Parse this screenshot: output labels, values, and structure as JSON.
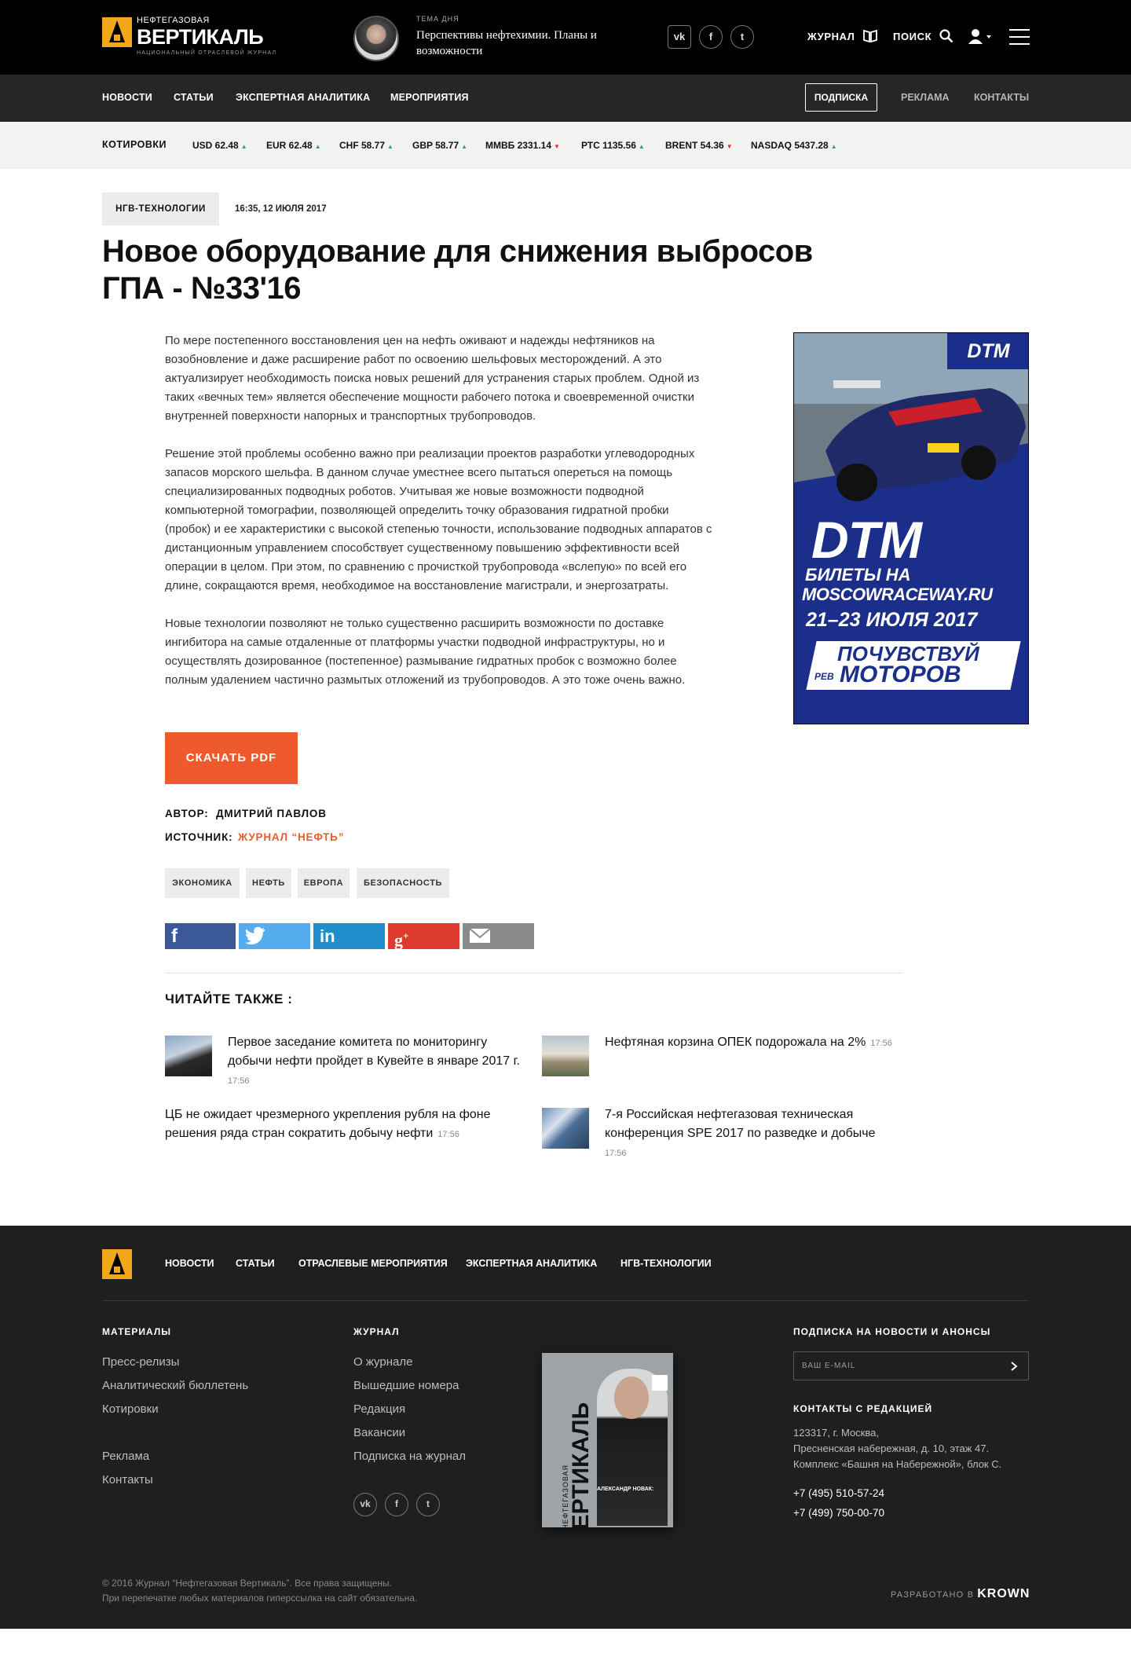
{
  "header": {
    "logo_small": "НЕФТЕГАЗОВАЯ",
    "logo_big": "ВЕРТИКАЛЬ",
    "logo_sub": "НАЦИОНАЛЬНЫЙ ОТРАСЛЕВОЙ ЖУРНАЛ",
    "theme_label": "ТЕМА ДНЯ",
    "theme_text": "Перспективы нефтехимии. Планы и возможности",
    "social": [
      "vk-icon",
      "facebook-icon",
      "twitter-icon"
    ],
    "journal_label": "ЖУРНАЛ",
    "search_label": "ПОИСК"
  },
  "nav": {
    "items": [
      "НОВОСТИ",
      "СТАТЬИ",
      "ЭКСПЕРТНАЯ АНАЛИТИКА",
      "МЕРОПРИЯТИЯ"
    ],
    "subscribe": "ПОДПИСКА",
    "ads": "РЕКЛАМА",
    "contacts": "КОНТАКТЫ"
  },
  "quotes": {
    "title": "КОТИРОВКИ",
    "items": [
      {
        "label": "USD 62.48",
        "dir": "up"
      },
      {
        "label": "EUR 62.48",
        "dir": "up"
      },
      {
        "label": "CHF 58.77",
        "dir": "up"
      },
      {
        "label": "GBP 58.77",
        "dir": "up"
      },
      {
        "label": "ММВБ 2331.14",
        "dir": "down"
      },
      {
        "label": "РТС 1135.56",
        "dir": "up"
      },
      {
        "label": "BRENT 54.36",
        "dir": "down"
      },
      {
        "label": "NASDAQ 5437.28",
        "dir": "up"
      }
    ]
  },
  "article": {
    "category": "НГВ-ТЕХНОЛОГИИ",
    "date": "16:35, 12 ИЮЛЯ 2017",
    "title": "Новое оборудование для снижения выбросов ГПА - №33'16",
    "p1": "По мере постепенного восстановления цен на нефть оживают и надежды нефтяников на возобновление и даже расширение работ по освоению шельфовых месторождений. А это актуализирует необходимость поиска новых решений для устранения старых проблем. Одной из таких «вечных тем» является обеспечение мощности рабочего потока и своевременной очистки внутренней поверхности напорных и транспортных трубопроводов.",
    "p2": "Решение этой проблемы особенно важно при реализации проектов разработки углеводородных запасов морского шельфа. В данном случае уместнее всего пытаться опереться на помощь специализированных подводных роботов. Учитывая же новые возможности подводной компьютерной томографии, позволяющей определить точку образования гидратной пробки (пробок) и ее характеристики с высокой степенью точности, использование подводных аппаратов с дистанционным управлением способствует существенному повышению эффективности всей операции в целом. При этом, по сравнению с прочисткой трубопровода «вслепую» по всей его длине, сокращаются время, необходимое на восстановление магистрали, и энергозатраты.",
    "p3": "Новые технологии позволяют не только существенно расширить возможности по доставке ингибитора на самые отдаленные от платформы участки подводной инфраструктуры, но и осуществлять дозированное (постепенное) размывание гидратных пробок с возможно более полным удалением частично размытых отложений из трубопроводов. А это тоже очень важно.",
    "download": "СКАЧАТЬ PDF",
    "author_label": "АВТОР:",
    "author": "ДМИТРИЙ ПАВЛОВ",
    "source_label": "ИСТОЧНИК:",
    "source": "ЖУРНАЛ “НЕФТЬ”",
    "tags": [
      "ЭКОНОМИКА",
      "НЕФТЬ",
      "ЕВРОПА",
      "БЕЗОПАСНОСТЬ"
    ],
    "share": [
      "facebook-icon",
      "twitter-icon",
      "linkedin-icon",
      "google-plus-icon",
      "email-icon"
    ]
  },
  "colors": {
    "accent": "#ef5a2c",
    "facebook": "#3b5998",
    "twitter": "#55acee",
    "linkedin": "#1f8ecb",
    "googleplus": "#dc3b2e",
    "email": "#8a8a8a",
    "logo": "#f2a81d"
  },
  "ad": {
    "brand": "DTM",
    "big": "DTM",
    "line1": "БИЛЕТЫ НА",
    "line2": "MOSCOWRACEWAY.RU",
    "dates": "21–23 ИЮЛЯ 2017",
    "slogan1": "ПОЧУВСТВУЙ",
    "slogan_small": "РЕВ",
    "slogan2": "МОТОРОВ"
  },
  "related": {
    "title": "ЧИТАЙТЕ ТАКЖЕ :",
    "items": [
      {
        "text": "Первое заседание комитета по мониторингу добычи нефти пройдет в Кувейте в январе 2017 г.",
        "time": "17:56"
      },
      {
        "text": "Нефтяная корзина ОПЕК подорожала на 2%",
        "time": "17:56"
      },
      {
        "text": "ЦБ не ожидает чрезмерного укрепления рубля на фоне решения ряда стран сократить добычу нефти",
        "time": "17:56"
      },
      {
        "text": "7-я Российская нефтегазовая техническая конференция SPE 2017 по разведке и добыче",
        "time": "17:56"
      }
    ]
  },
  "footer": {
    "nav": [
      "НОВОСТИ",
      "СТАТЬИ",
      "ОТРАСЛЕВЫЕ МЕРОПРИЯТИЯ",
      "ЭКСПЕРТНАЯ АНАЛИТИКА",
      "НГВ-ТЕХНОЛОГИИ"
    ],
    "materials_title": "МАТЕРИАЛЫ",
    "materials": [
      "Пресс-релизы",
      "Аналитический бюллетень",
      "Котировки"
    ],
    "materials2": [
      "Реклама",
      "Контакты"
    ],
    "journal_title": "ЖУРНАЛ",
    "journal": [
      "О журнале",
      "Вышедшие номера",
      "Редакция",
      "Вакансии",
      "Подписка на журнал"
    ],
    "subscribe_title": "ПОДПИСКА НА НОВОСТИ И АНОНСЫ",
    "email_placeholder": "ВАШ E-MAIL",
    "contacts_title": "КОНТАКТЫ С РЕДАКЦИЕЙ",
    "address": [
      "123317, г. Москва,",
      "Пресненская набережная, д. 10, этаж 47.",
      "Комплекс «Башня на Набережной», блок С."
    ],
    "phones": [
      "+7 (495) 510-57-24",
      "+7 (499) 750-00-70"
    ],
    "magazine_title1": "НЕФТЕГАЗОВАЯ",
    "magazine_title2": "ВЕРТИКАЛЬ",
    "magazine_caption": "АЛЕКСАНДР НОВАК:",
    "copyright1": "© 2016 Журнал “Нефтегазовая Вертикаль”. Все права защищены.",
    "copyright2": "При перепечатке любых материалов гиперссылка на сайт обязательна.",
    "dev_label": "РАЗРАБОТАНО В",
    "dev_brand": "KROWN"
  }
}
